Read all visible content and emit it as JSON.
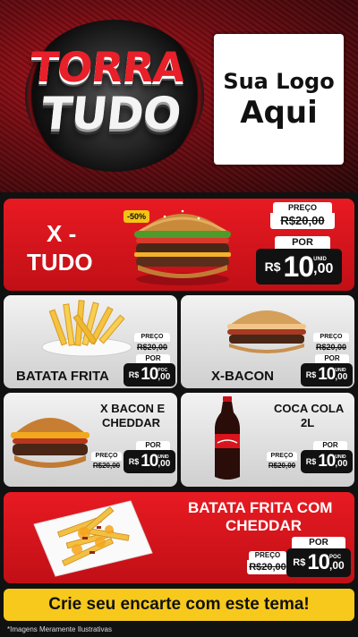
{
  "brand": {
    "title_line1": "TORRA",
    "title_line2": "TUDO",
    "logo_line1": "Sua Logo",
    "logo_line2": "Aqui"
  },
  "items": {
    "x_tudo": {
      "name_line1": "X -",
      "name_line2": "TUDO",
      "badge": "-50%",
      "price_label": "PREÇO",
      "old_price": "R$20,00",
      "por_label": "POR",
      "currency": "R$",
      "price_int": "10",
      "price_cents": ",00",
      "unit": "UNID"
    },
    "batata_frita": {
      "name": "BATATA FRITA",
      "price_label": "PREÇO",
      "old_price": "R$20,00",
      "por_label": "POR",
      "currency": "R$",
      "price_int": "10",
      "price_cents": ",00",
      "unit": "POC"
    },
    "x_bacon": {
      "name": "X-BACON",
      "price_label": "PREÇO",
      "old_price": "R$20,00",
      "por_label": "POR",
      "currency": "R$",
      "price_int": "10",
      "price_cents": ",00",
      "unit": "UNID"
    },
    "x_bacon_cheddar": {
      "name_line1": "X BACON E",
      "name_line2": "CHEDDAR",
      "price_label": "PREÇO",
      "old_price": "R$20,00",
      "por_label": "POR",
      "currency": "R$",
      "price_int": "10",
      "price_cents": ",00",
      "unit": "UNID"
    },
    "coca_cola": {
      "name_line1": "COCA COLA",
      "name_line2": "2L",
      "price_label": "PREÇO",
      "old_price": "R$20,00",
      "por_label": "POR",
      "currency": "R$",
      "price_int": "10",
      "price_cents": ",00",
      "unit": "UNID"
    },
    "batata_cheddar": {
      "name_line1": "BATATA FRITA COM",
      "name_line2": "CHEDDAR",
      "price_label": "PREÇO",
      "old_price": "R$20,00",
      "por_label": "POR",
      "currency": "R$",
      "price_int": "10",
      "price_cents": ",00",
      "unit": "POC"
    }
  },
  "footer": {
    "cta": "Crie seu encarte com este tema!",
    "disclaimer": "*Imagens Meramente Ilustrativas"
  },
  "colors": {
    "accent_red": "#e81a22",
    "cta_yellow": "#f7c91c",
    "price_box": "#111111"
  }
}
